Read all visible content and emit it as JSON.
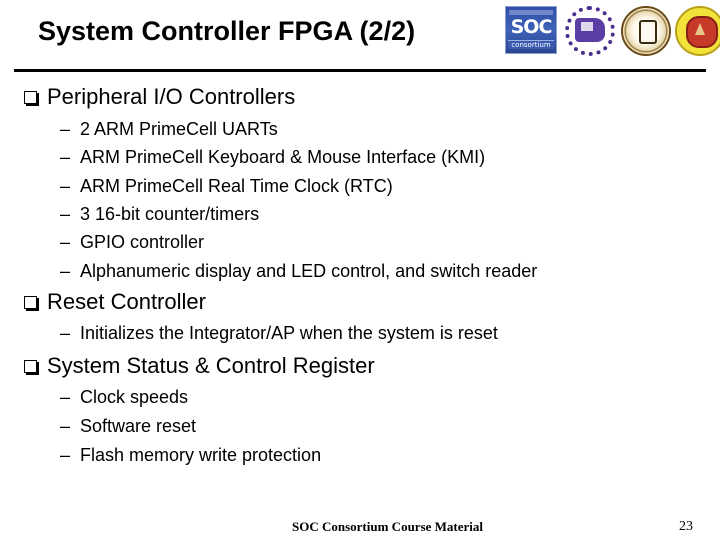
{
  "slide": {
    "title": "System Controller FPGA (2/2)",
    "logos": [
      {
        "name": "soc-consortium-logo",
        "text": "SOC",
        "subtext": "consortium"
      },
      {
        "name": "purple-university-seal"
      },
      {
        "name": "gold-university-seal"
      },
      {
        "name": "yellow-red-university-seal"
      }
    ],
    "sections": [
      {
        "heading": "Peripheral I/O Controllers",
        "items": [
          "2 ARM PrimeCell UARTs",
          "ARM PrimeCell Keyboard & Mouse Interface (KMI)",
          "ARM PrimeCell Real Time Clock (RTC)",
          "3 16-bit counter/timers",
          "GPIO controller",
          "Alphanumeric display and LED control, and switch reader"
        ]
      },
      {
        "heading": "Reset Controller",
        "items": [
          "Initializes the Integrator/AP when the system is reset"
        ]
      },
      {
        "heading": "System Status & Control Register",
        "items": [
          "Clock speeds",
          "Software reset",
          "Flash memory write protection"
        ]
      }
    ],
    "dash": "–",
    "footer": "SOC Consortium Course Material",
    "page_number": "23"
  }
}
